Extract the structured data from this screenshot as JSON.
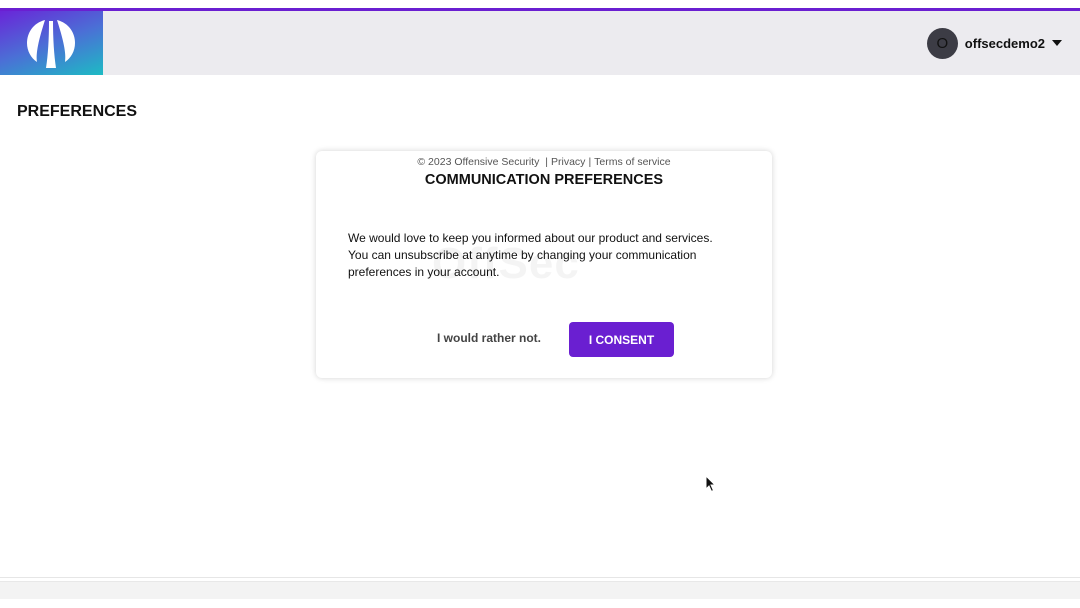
{
  "colors": {
    "accent": "#6a1fd1",
    "topbar_bg": "#ecebef",
    "logo_gradient": [
      "#6a25d8",
      "#1dbbc4"
    ]
  },
  "header": {
    "logo_icon": "offsec-logo-icon",
    "user": {
      "avatar_initial": "O",
      "username": "offsecdemo2",
      "menu_icon": "caret-down-icon"
    }
  },
  "page": {
    "title": "PREFERENCES"
  },
  "dialog": {
    "copyright": "© 2023  Offensive Security",
    "privacy_link": "Privacy",
    "terms_link": "Terms of service",
    "separator": "|",
    "title": "COMMUNICATION PREFERENCES",
    "body_lines": [
      "We would love to keep you informed about our product and services.",
      "You can unsubscribe at anytime by changing your communication",
      "preferences in your account."
    ],
    "decline_label": "I would rather not.",
    "consent_label": "I CONSENT"
  }
}
